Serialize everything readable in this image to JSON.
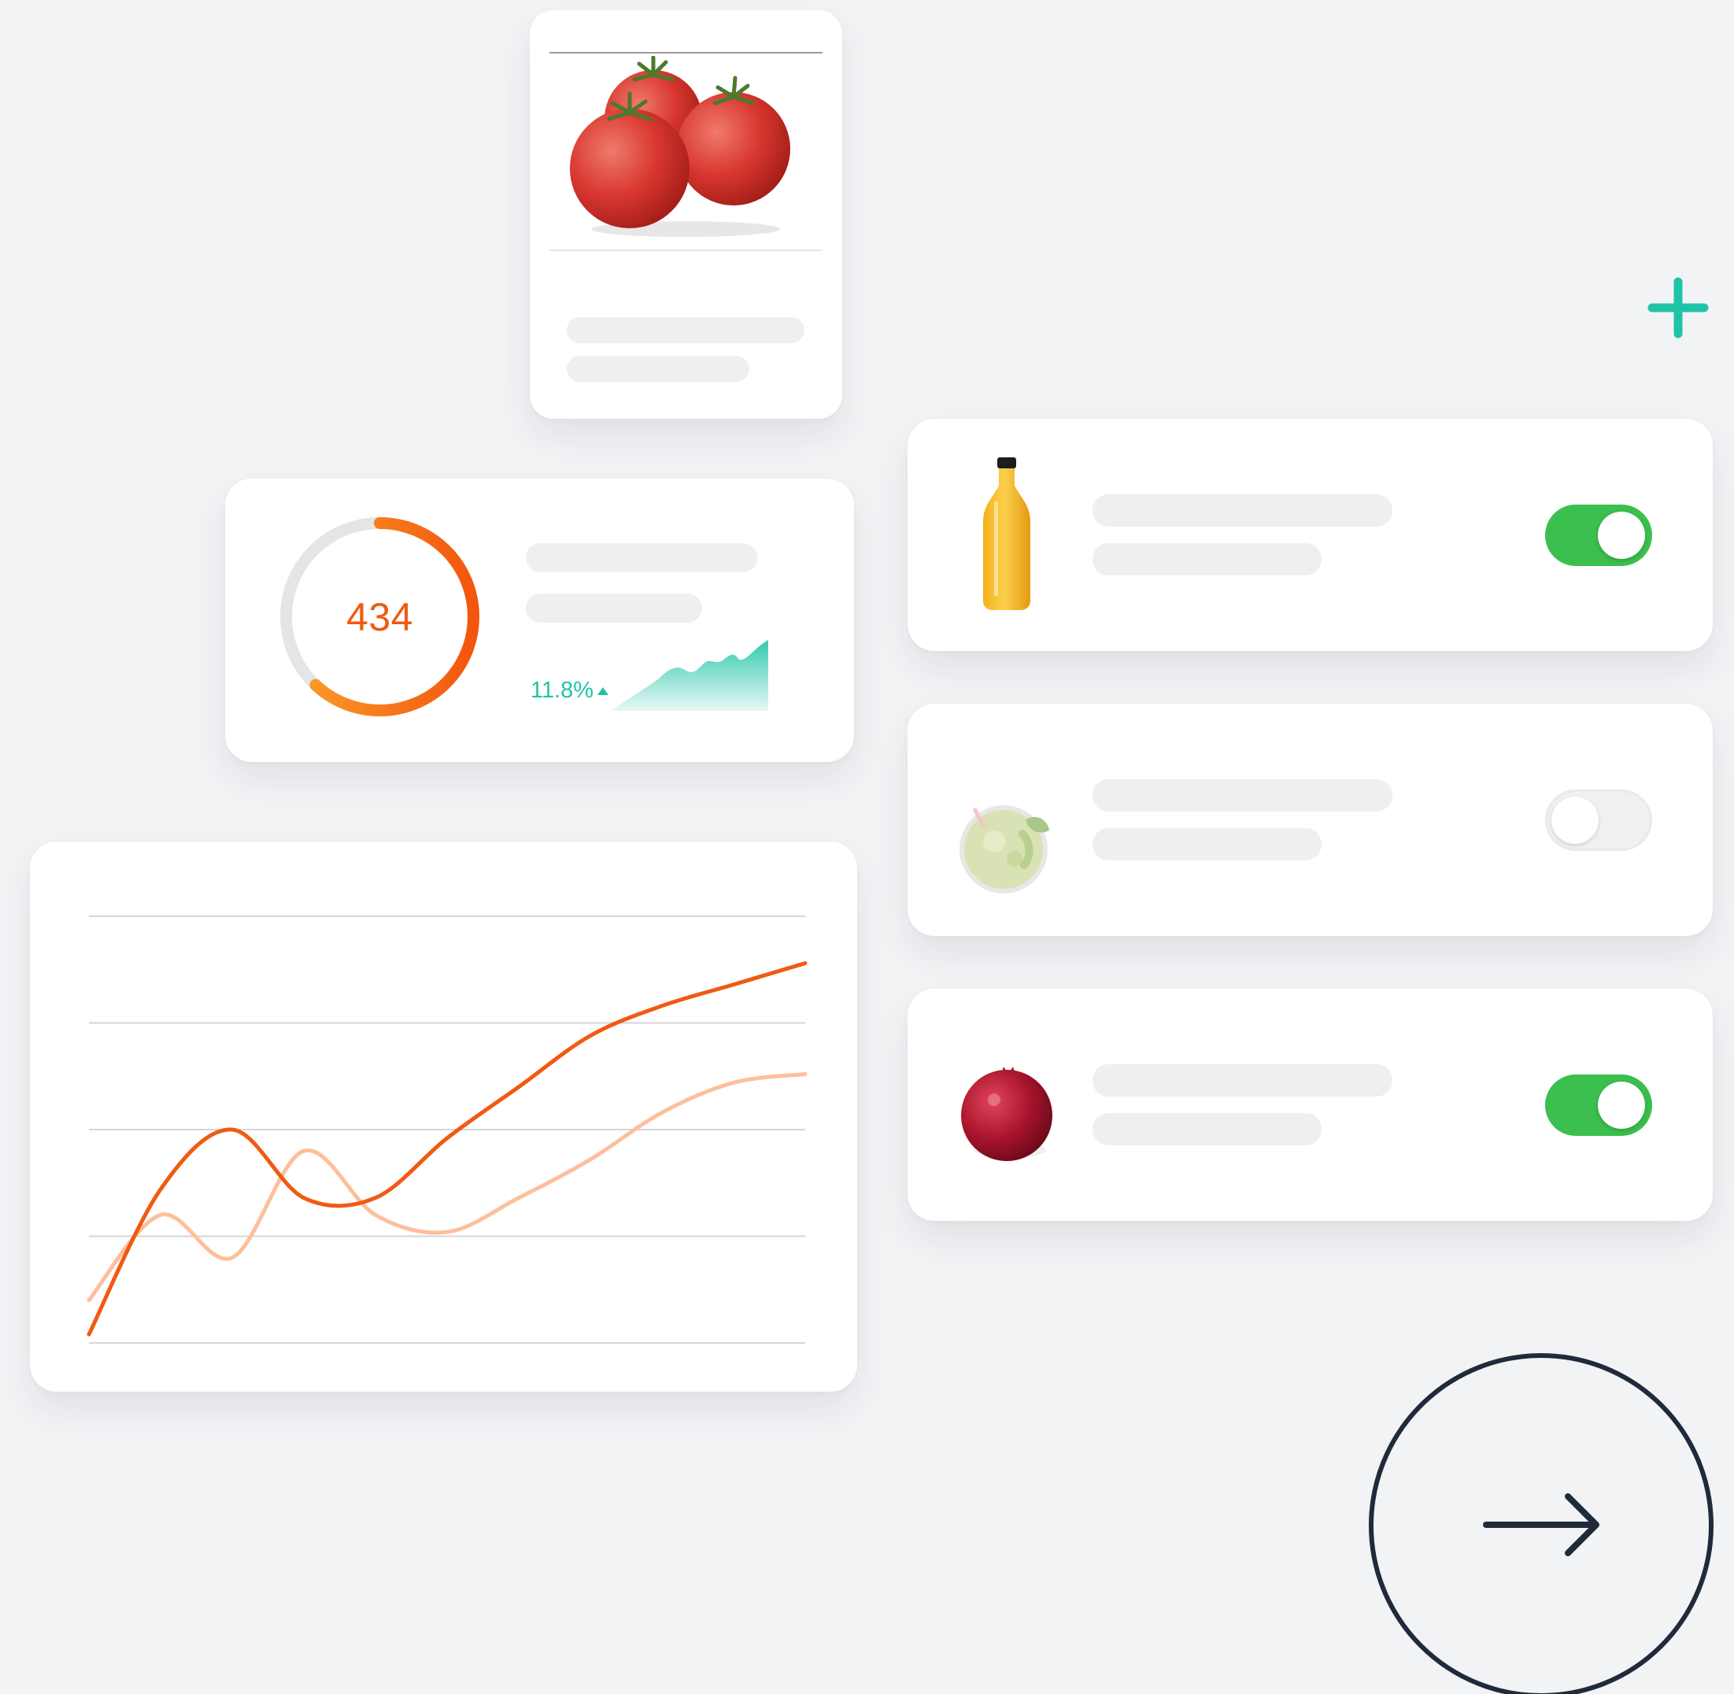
{
  "colors": {
    "background": "#f2f3f5",
    "card": "#ffffff",
    "accent_orange": "#f05a13",
    "accent_orange_light": "#fdbf9b",
    "teal": "#21c3a8",
    "toggle_on": "#3bbf4e",
    "dark": "#1f2a3a"
  },
  "product_card": {
    "image_icon": "tomatoes-icon"
  },
  "stats_card": {
    "donut_value": "434",
    "donut_progress": 0.62,
    "trend_percent": "11.8%",
    "trend_direction": "up"
  },
  "items": [
    {
      "thumb_icon": "juice-bottle-icon",
      "toggle_on": true
    },
    {
      "thumb_icon": "smoothie-glass-icon",
      "toggle_on": false
    },
    {
      "thumb_icon": "pomegranate-icon",
      "toggle_on": true
    }
  ],
  "actions": {
    "add_icon": "plus-icon",
    "next_icon": "arrow-right-icon"
  },
  "chart_data": {
    "type": "line",
    "title": "",
    "xlabel": "",
    "ylabel": "",
    "gridlines": 5,
    "ylim": [
      0,
      100
    ],
    "series": [
      {
        "color": "#f05a13",
        "x": [
          0,
          10,
          20,
          30,
          40,
          50,
          60,
          70,
          80,
          90,
          100
        ],
        "values": [
          2,
          36,
          50,
          34,
          34,
          48,
          60,
          72,
          79,
          84,
          89
        ]
      },
      {
        "color": "#fdbf9b",
        "x": [
          0,
          10,
          20,
          30,
          40,
          50,
          60,
          70,
          80,
          90,
          100
        ],
        "values": [
          10,
          30,
          20,
          45,
          30,
          26,
          34,
          43,
          54,
          61,
          63
        ]
      }
    ]
  }
}
